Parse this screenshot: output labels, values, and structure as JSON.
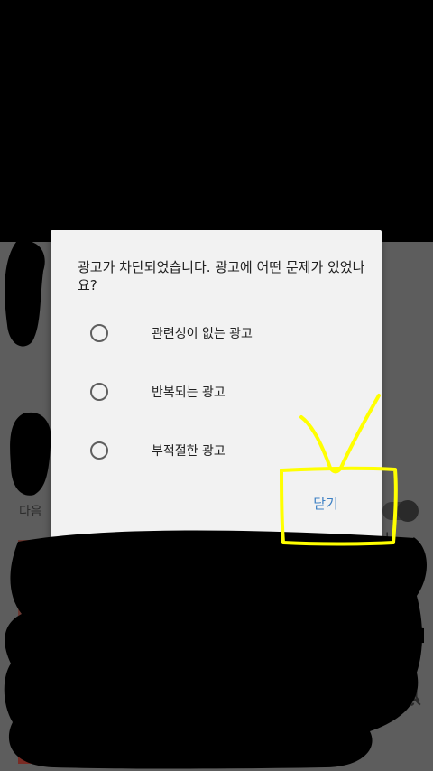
{
  "dialog": {
    "title": "광고가 차단되었습니다. 광고에 어떤 문제가 있었나요?",
    "options": [
      {
        "label": "관련성이 없는 광고",
        "selected": false
      },
      {
        "label": "반복되는 광고",
        "selected": false
      },
      {
        "label": "부적절한 광고",
        "selected": false
      }
    ],
    "close_label": "닫기"
  },
  "background": {
    "next_label": "다음"
  },
  "colors": {
    "dialog_background": "#f2f2f2",
    "close_text": "#3d80c4",
    "highlight_annotation": "#ffff00",
    "redaction": "#000000"
  }
}
